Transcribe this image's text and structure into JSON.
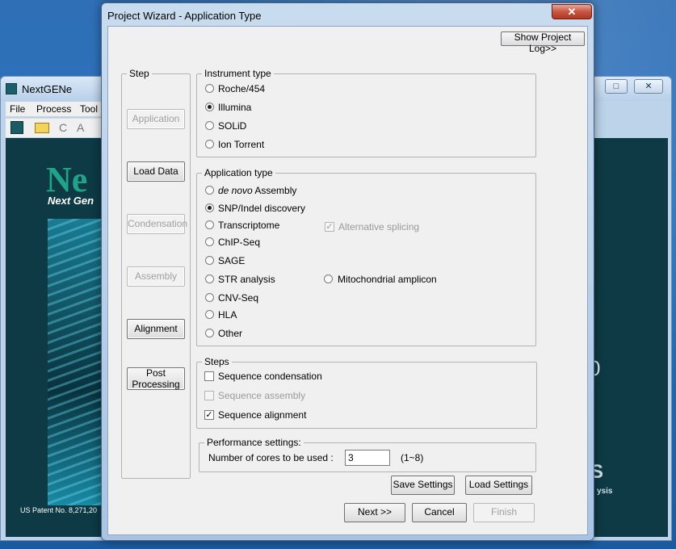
{
  "background_window": {
    "title": "NextGENe",
    "controls": [
      "□",
      "✕"
    ],
    "menu": [
      "File",
      "Process",
      "Tool"
    ],
    "tool_icons": [
      "C",
      "A"
    ],
    "brand": "Ne",
    "tagline": "Next Gen",
    "patent": "US Patent No. 8,271,20",
    "right_mark": "0",
    "right_logo": "S",
    "right_sub": "ysis"
  },
  "dialog": {
    "title": "Project Wizard - Application Type",
    "close_glyph": "✕",
    "show_log_button": "Show Project Log>>",
    "step_group_label": "Step",
    "steps": [
      {
        "label": "Application",
        "enabled": false
      },
      {
        "label": "Load Data",
        "enabled": true
      },
      {
        "label": "Condensation",
        "enabled": false
      },
      {
        "label": "Assembly",
        "enabled": false
      },
      {
        "label": "Alignment",
        "enabled": true
      },
      {
        "label": "Post Processing",
        "enabled": true
      }
    ],
    "instrument": {
      "label": "Instrument type",
      "options": [
        "Roche/454",
        "Illumina",
        "SOLiD",
        "Ion Torrent"
      ],
      "selected": "Illumina"
    },
    "application": {
      "label": "Application type",
      "denovo_italic": "de novo",
      "denovo_rest": "Assembly",
      "options": [
        "SNP/Indel discovery",
        "Transcriptome",
        "ChIP-Seq",
        "SAGE",
        "STR analysis",
        "CNV-Seq",
        "HLA",
        "Other"
      ],
      "selected": "SNP/Indel discovery",
      "alt_splicing": "Alternative splicing",
      "alt_splicing_checked": true,
      "mito": "Mitochondrial amplicon"
    },
    "steps_group": {
      "label": "Steps",
      "items": [
        {
          "label": "Sequence condensation",
          "checked": false,
          "enabled": true
        },
        {
          "label": "Sequence assembly",
          "checked": false,
          "enabled": false
        },
        {
          "label": "Sequence alignment",
          "checked": true,
          "enabled": true
        }
      ]
    },
    "performance": {
      "label": "Performance settings:",
      "cores_label": "Number of cores to be used :",
      "cores_value": "3",
      "cores_range": "(1~8)"
    },
    "buttons": {
      "save_settings": "Save Settings",
      "load_settings": "Load Settings",
      "next": "Next >>",
      "cancel": "Cancel",
      "finish": "Finish"
    }
  }
}
